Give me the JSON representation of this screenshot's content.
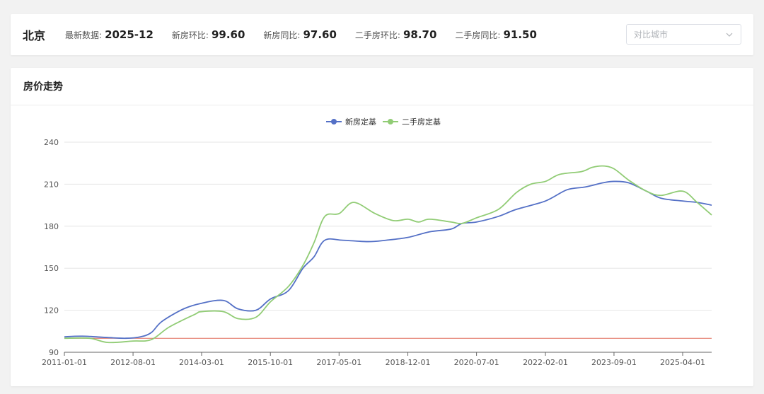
{
  "header": {
    "city": "北京",
    "stats": [
      {
        "label": "最新数据:",
        "value": "2025-12"
      },
      {
        "label": "新房环比:",
        "value": "99.60"
      },
      {
        "label": "新房同比:",
        "value": "97.60"
      },
      {
        "label": "二手房环比:",
        "value": "98.70"
      },
      {
        "label": "二手房同比:",
        "value": "91.50"
      }
    ],
    "compare_placeholder": "对比城市"
  },
  "chart_card": {
    "title": "房价走势"
  },
  "chart_data": {
    "type": "line",
    "ylim": [
      90,
      240
    ],
    "yticks": [
      90,
      120,
      150,
      180,
      210,
      240
    ],
    "xlim": [
      "2011-01-01",
      "2025-12-01"
    ],
    "xticks": [
      "2011-01-01",
      "2012-08-01",
      "2014-03-01",
      "2015-10-01",
      "2017-05-01",
      "2018-12-01",
      "2020-07-01",
      "2022-02-01",
      "2023-09-01",
      "2025-04-01"
    ],
    "grid": true,
    "legend_position": "top-center",
    "reference_line": {
      "y": 100,
      "color": "#e06c5a"
    },
    "series": [
      {
        "name": "新房定基",
        "color": "#5470c6",
        "points": [
          [
            "2011-01-01",
            101
          ],
          [
            "2011-06-01",
            101.5
          ],
          [
            "2012-01-01",
            100.5
          ],
          [
            "2012-06-01",
            100
          ],
          [
            "2012-10-01",
            101
          ],
          [
            "2013-01-01",
            104
          ],
          [
            "2013-04-01",
            112
          ],
          [
            "2013-10-01",
            121
          ],
          [
            "2014-03-01",
            125
          ],
          [
            "2014-09-01",
            127
          ],
          [
            "2015-01-01",
            121
          ],
          [
            "2015-06-01",
            120
          ],
          [
            "2015-10-01",
            128
          ],
          [
            "2016-03-01",
            134
          ],
          [
            "2016-07-01",
            150
          ],
          [
            "2016-10-01",
            158
          ],
          [
            "2017-01-01",
            170
          ],
          [
            "2017-06-01",
            170
          ],
          [
            "2018-01-01",
            169
          ],
          [
            "2018-06-01",
            170
          ],
          [
            "2018-12-01",
            172
          ],
          [
            "2019-06-01",
            176
          ],
          [
            "2019-12-01",
            178
          ],
          [
            "2020-03-01",
            182
          ],
          [
            "2020-07-01",
            183
          ],
          [
            "2021-01-01",
            187
          ],
          [
            "2021-06-01",
            192
          ],
          [
            "2022-02-01",
            198
          ],
          [
            "2022-08-01",
            206
          ],
          [
            "2023-01-01",
            208
          ],
          [
            "2023-06-01",
            211
          ],
          [
            "2023-09-01",
            212
          ],
          [
            "2024-01-01",
            211
          ],
          [
            "2024-06-01",
            205
          ],
          [
            "2024-10-01",
            200
          ],
          [
            "2025-04-01",
            198
          ],
          [
            "2025-08-01",
            197
          ],
          [
            "2025-12-01",
            195
          ]
        ]
      },
      {
        "name": "二手房定基",
        "color": "#91cc75",
        "points": [
          [
            "2011-01-01",
            100
          ],
          [
            "2011-08-01",
            100
          ],
          [
            "2012-01-01",
            97
          ],
          [
            "2012-08-01",
            98
          ],
          [
            "2013-01-01",
            99
          ],
          [
            "2013-06-01",
            108
          ],
          [
            "2014-01-01",
            117
          ],
          [
            "2014-03-01",
            119
          ],
          [
            "2014-09-01",
            119
          ],
          [
            "2015-01-01",
            114
          ],
          [
            "2015-06-01",
            115
          ],
          [
            "2015-10-01",
            126
          ],
          [
            "2016-03-01",
            137
          ],
          [
            "2016-07-01",
            152
          ],
          [
            "2016-10-01",
            168
          ],
          [
            "2017-01-01",
            187
          ],
          [
            "2017-05-01",
            189
          ],
          [
            "2017-09-01",
            197
          ],
          [
            "2018-03-01",
            189
          ],
          [
            "2018-08-01",
            184
          ],
          [
            "2018-12-01",
            185
          ],
          [
            "2019-03-01",
            183
          ],
          [
            "2019-06-01",
            185
          ],
          [
            "2019-12-01",
            183
          ],
          [
            "2020-03-01",
            182
          ],
          [
            "2020-07-01",
            186
          ],
          [
            "2021-01-01",
            192
          ],
          [
            "2021-06-01",
            204
          ],
          [
            "2021-10-01",
            210
          ],
          [
            "2022-02-01",
            212
          ],
          [
            "2022-06-01",
            217
          ],
          [
            "2022-12-01",
            219
          ],
          [
            "2023-03-01",
            222
          ],
          [
            "2023-06-01",
            223
          ],
          [
            "2023-09-01",
            221
          ],
          [
            "2024-01-01",
            213
          ],
          [
            "2024-06-01",
            205
          ],
          [
            "2024-10-01",
            202
          ],
          [
            "2025-04-01",
            205
          ],
          [
            "2025-08-01",
            197
          ],
          [
            "2025-12-01",
            188
          ]
        ]
      }
    ]
  }
}
